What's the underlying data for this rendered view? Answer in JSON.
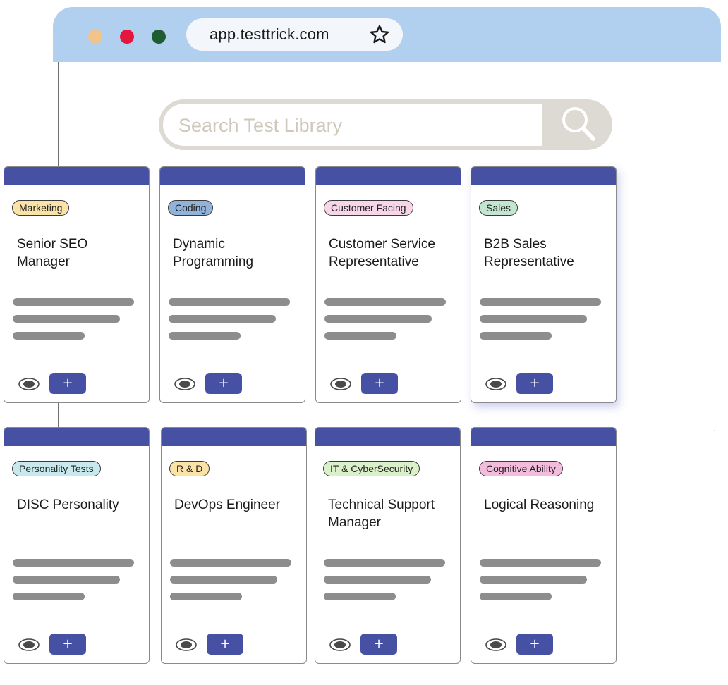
{
  "browser": {
    "url": "app.testtrick.com",
    "dots": [
      "#f0c48b",
      "#e3163d",
      "#1e5c32"
    ]
  },
  "search": {
    "placeholder": "Search Test Library",
    "icon": "search-icon"
  },
  "colors": {
    "card_header": "#4751a4",
    "button": "#4751a4",
    "browser_bar": "#b1cfee"
  },
  "cards": [
    {
      "tag": "Marketing",
      "tag_color": "#fbe3a7",
      "title": "Senior SEO Manager",
      "add_label": "+",
      "view_icon": "eye-icon"
    },
    {
      "tag": "Coding",
      "tag_color": "#92b3d9",
      "title": "Dynamic Programming",
      "add_label": "+",
      "view_icon": "eye-icon"
    },
    {
      "tag": "Customer Facing",
      "tag_color": "#f7d6ea",
      "title": "Customer Service Representative",
      "add_label": "+",
      "view_icon": "eye-icon"
    },
    {
      "tag": "Sales",
      "tag_color": "#c3e6d1",
      "title": "B2B Sales Representative",
      "add_label": "+",
      "view_icon": "eye-icon"
    },
    {
      "tag": "Personality Tests",
      "tag_color": "#c7e9ed",
      "title": "DISC Personality",
      "add_label": "+",
      "view_icon": "eye-icon"
    },
    {
      "tag": "R & D",
      "tag_color": "#fbe3a7",
      "title": "DevOps Engineer",
      "add_label": "+",
      "view_icon": "eye-icon"
    },
    {
      "tag": "IT & CyberSecurity",
      "tag_color": "#daf0c9",
      "title": "Technical Support Manager",
      "add_label": "+",
      "view_icon": "eye-icon"
    },
    {
      "tag": "Cognitive Ability",
      "tag_color": "#f3bcdc",
      "title": "Logical Reasoning",
      "add_label": "+",
      "view_icon": "eye-icon"
    }
  ]
}
